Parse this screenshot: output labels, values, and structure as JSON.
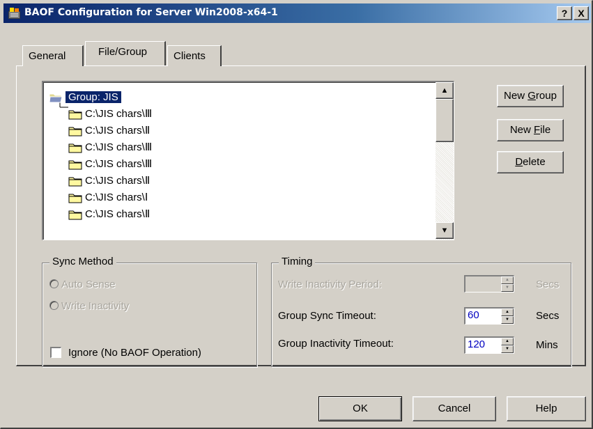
{
  "window": {
    "title": "BAOF Configuration for Server Win2008-x64-1",
    "help_button": "?",
    "close_button": "X"
  },
  "tabs": [
    {
      "label": "General",
      "active": false
    },
    {
      "label": "File/Group",
      "active": true
    },
    {
      "label": "Clients",
      "active": false
    }
  ],
  "tree": {
    "group_label": "Group: JIS",
    "items": [
      "C:\\JIS chars\\Ⅲ",
      "C:\\JIS chars\\Ⅱ",
      "C:\\JIS chars\\Ⅲ",
      "C:\\JIS chars\\Ⅲ",
      "C:\\JIS chars\\Ⅱ",
      "C:\\JIS chars\\Ⅰ",
      "C:\\JIS chars\\Ⅱ"
    ]
  },
  "side_buttons": {
    "new_group_prefix": "New ",
    "new_group_key": "G",
    "new_group_rest": "roup",
    "new_file_prefix": "New ",
    "new_file_key": "F",
    "new_file_rest": "ile",
    "delete_key": "D",
    "delete_rest": "elete"
  },
  "sync_method": {
    "legend": "Sync Method",
    "auto_sense": "Auto Sense",
    "write_inactivity": "Write Inactivity",
    "ignore": "Ignore (No BAOF Operation)"
  },
  "timing": {
    "legend": "Timing",
    "write_inactivity_label": "Write Inactivity Period:",
    "write_inactivity_value": "",
    "write_inactivity_unit": "Secs",
    "group_sync_label": "Group Sync Timeout:",
    "group_sync_value": "60",
    "group_sync_unit": "Secs",
    "group_inactivity_label": "Group Inactivity Timeout:",
    "group_inactivity_value": "120",
    "group_inactivity_unit": "Mins"
  },
  "footer": {
    "ok": "OK",
    "cancel": "Cancel",
    "help": "Help"
  },
  "colors": {
    "titlebar_start": "#0a246a",
    "titlebar_end": "#a6caf0",
    "selection": "#0a246a",
    "spin_value": "#0000c0",
    "dialog_face": "#d4d0c8"
  }
}
